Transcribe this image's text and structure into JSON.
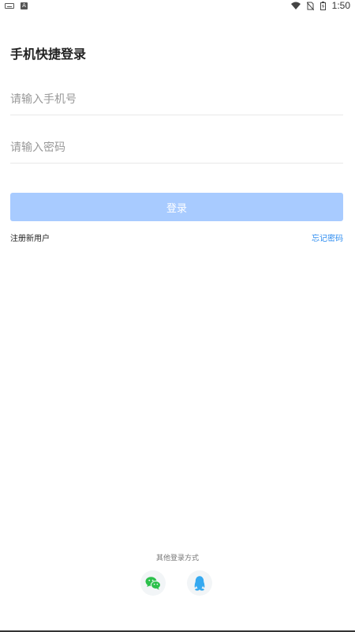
{
  "status_bar": {
    "time": "1:50",
    "left_icons": [
      "keyboard-icon",
      "a-badge-icon"
    ],
    "right_icons": [
      "wifi-icon",
      "no-sim-icon",
      "battery-icon"
    ]
  },
  "page": {
    "title": "手机快捷登录"
  },
  "form": {
    "phone_placeholder": "请输入手机号",
    "phone_value": "",
    "password_placeholder": "请输入密码",
    "password_value": "",
    "login_label": "登录"
  },
  "links": {
    "register": "注册新用户",
    "forgot": "忘记密码"
  },
  "other_login": {
    "label": "其他登录方式",
    "methods": [
      "wechat-icon",
      "qq-icon"
    ]
  },
  "colors": {
    "accent": "#2d8cf0",
    "button_disabled": "#a8cbff",
    "wechat": "#2cc04c",
    "qq": "#35a9f0"
  }
}
